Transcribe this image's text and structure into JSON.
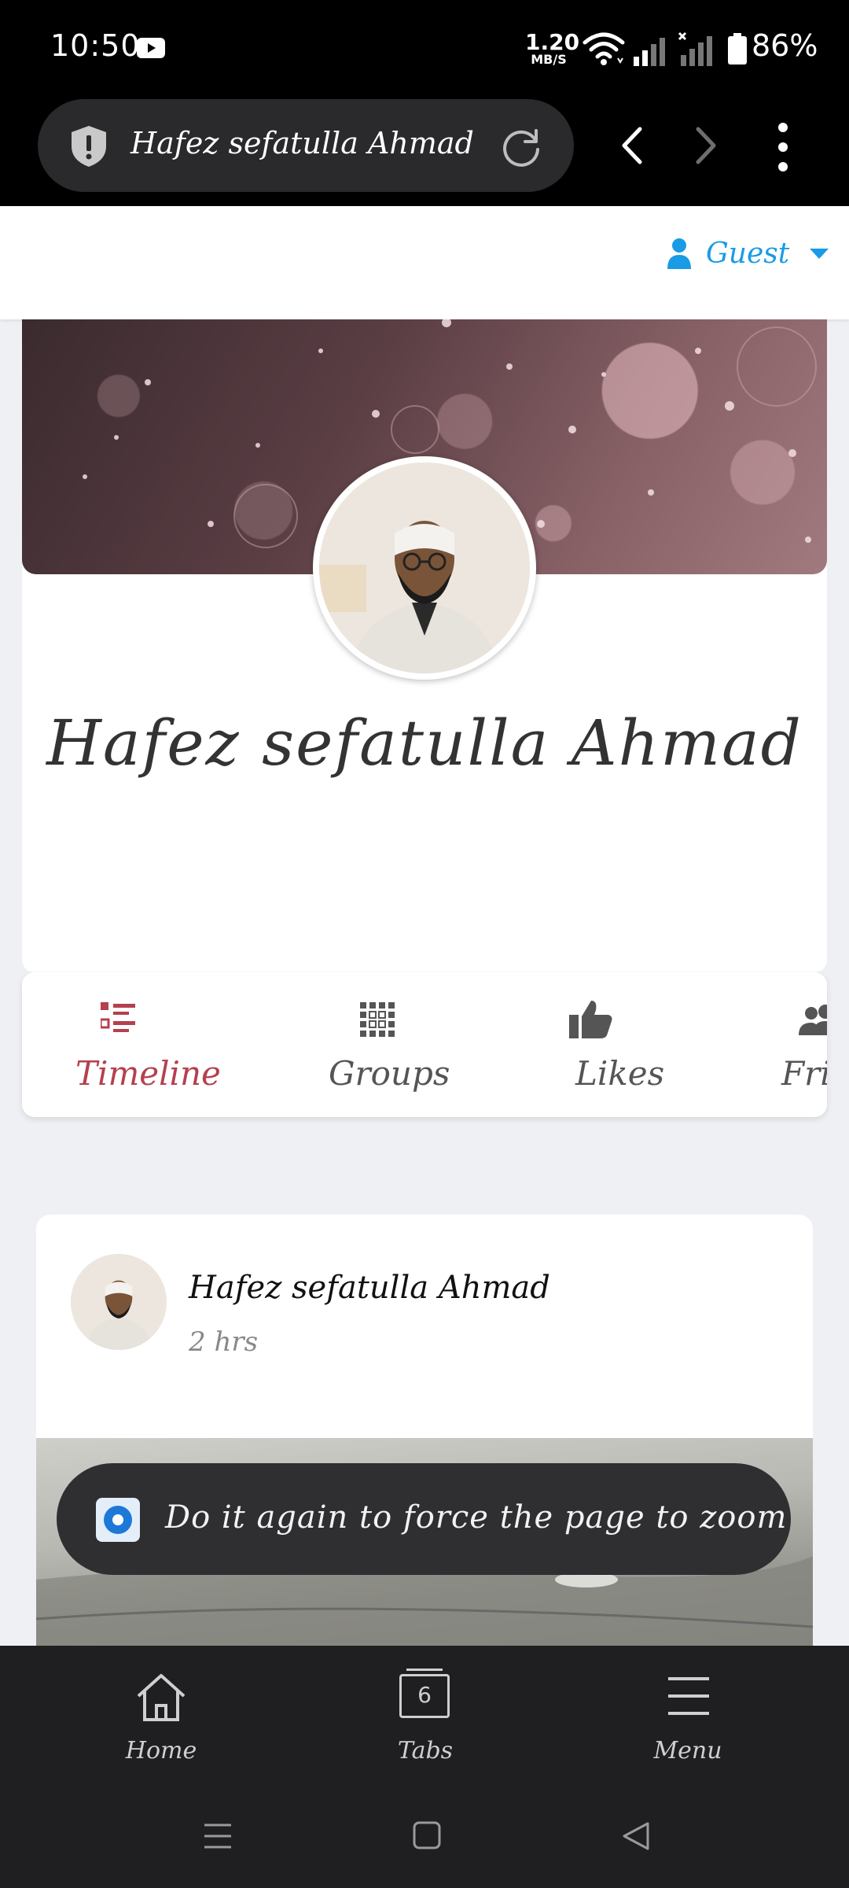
{
  "status_bar": {
    "time": "10:50",
    "net_speed_value": "1.20",
    "net_speed_unit": "MB/S",
    "battery": "86%"
  },
  "browser": {
    "url_title": "Hafez sefatulla Ahmad",
    "icons": [
      "shield-icon",
      "reload-icon",
      "back-icon",
      "forward-icon",
      "more-vertical-icon"
    ]
  },
  "header": {
    "user_label": "Guest"
  },
  "profile": {
    "name": "Hafez sefatulla Ahmad"
  },
  "tabs": [
    {
      "label": "Timeline",
      "active": true
    },
    {
      "label": "Groups"
    },
    {
      "label": "Likes"
    },
    {
      "label": "Frier"
    }
  ],
  "post": {
    "author": "Hafez sefatulla Ahmad",
    "time": "2 hrs"
  },
  "toast": {
    "message": "Do it again to force the page to zoom"
  },
  "bottom_toolbar": {
    "home_label": "Home",
    "tabs_label": "Tabs",
    "tabs_count": "6",
    "menu_label": "Menu"
  },
  "colors": {
    "accent_blue": "#1a9be6",
    "active_tab": "#b5404e",
    "inactive_tab": "#555555",
    "toolbar_bg": "#1f1f21"
  }
}
